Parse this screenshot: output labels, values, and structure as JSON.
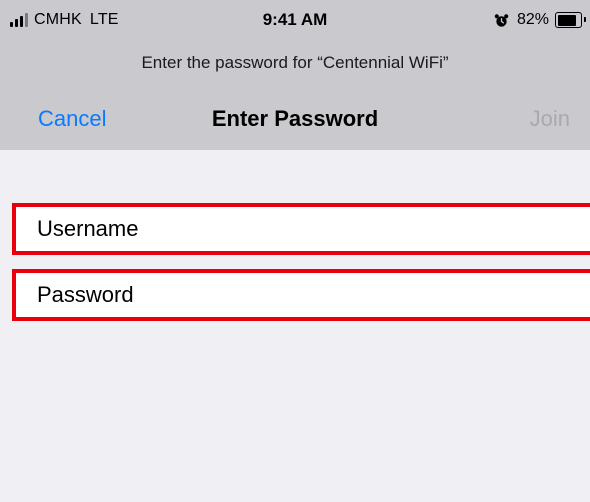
{
  "status_bar": {
    "carrier": "CMHK",
    "network": "LTE",
    "time": "9:41 AM",
    "battery_percent": "82%",
    "battery_level": 0.82,
    "icons": [
      "signal-icon",
      "alarm-icon",
      "battery-icon"
    ]
  },
  "prompt": "Enter the password for “Centennial WiFi”",
  "nav": {
    "cancel_label": "Cancel",
    "title": "Enter Password",
    "join_label": "Join"
  },
  "form": {
    "username": {
      "placeholder": "Username",
      "value": ""
    },
    "password": {
      "placeholder": "Password",
      "value": ""
    }
  },
  "colors": {
    "accent": "#0a7aff",
    "disabled": "#a9a9ae",
    "highlight_border": "#e8000d",
    "header_bg": "#c9c9ce",
    "page_bg": "#f0eff4"
  }
}
